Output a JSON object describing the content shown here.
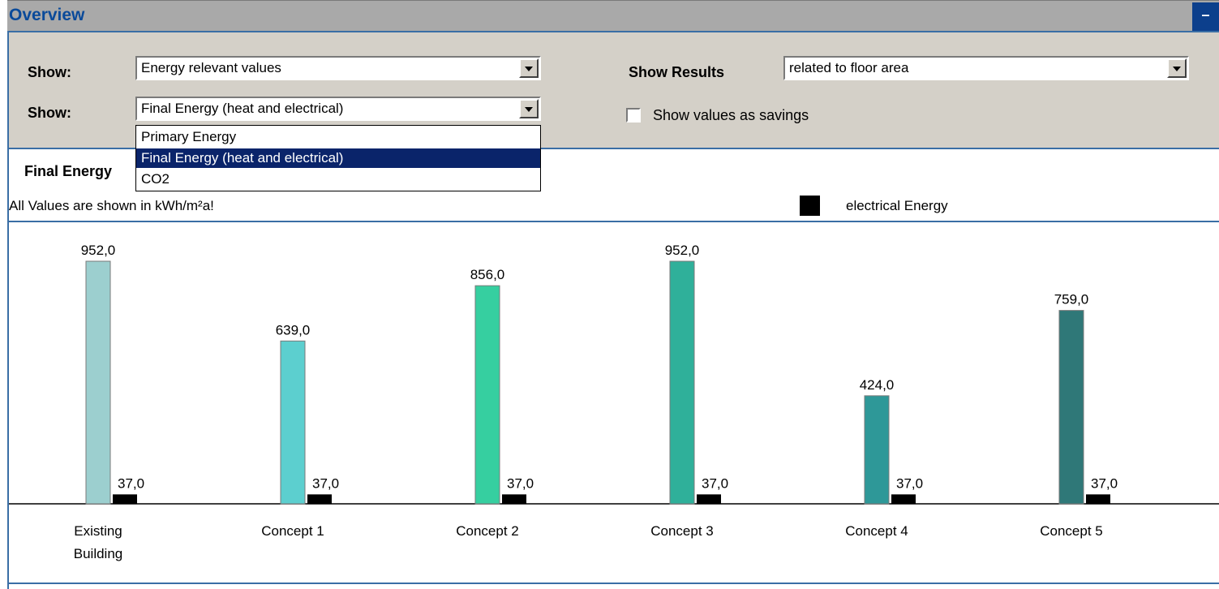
{
  "window": {
    "title": "Overview",
    "collapse_label": "–"
  },
  "filters": {
    "show1_label": "Show:",
    "show1_value": "Energy relevant values",
    "show2_label": "Show:",
    "show2_value": "Final Energy (heat and electrical)",
    "show_results_label": "Show Results",
    "show_results_value": "related to floor area",
    "savings_checkbox_label": "Show values as savings",
    "savings_checked": false
  },
  "dropdown": {
    "options": [
      "Primary Energy",
      "Final Energy (heat and electrical)",
      "CO2"
    ],
    "selected": "Final Energy (heat and electrical)"
  },
  "chart_header": {
    "title": "Final Energy",
    "unit_note": "All Values are shown in kWh/m²a!",
    "legend_label": "electrical Energy"
  },
  "colors": {
    "accent": "#3a6ea5",
    "selection": "#0a246a",
    "electrical": "#000000",
    "bars": [
      "#9ccfcf",
      "#5ccfcf",
      "#36cfa0",
      "#2fb09a",
      "#2e9898",
      "#2f7878"
    ]
  },
  "chart_data": {
    "type": "bar",
    "categories": [
      [
        "Existing",
        "Building"
      ],
      [
        "Concept 1"
      ],
      [
        "Concept 2"
      ],
      [
        "Concept 3"
      ],
      [
        "Concept 4"
      ],
      [
        "Concept 5"
      ]
    ],
    "series": [
      {
        "values": [
          952.0,
          639.0,
          856.0,
          952.0,
          424.0,
          759.0
        ],
        "labels": [
          "952,0",
          "639,0",
          "856,0",
          "952,0",
          "424,0",
          "759,0"
        ]
      },
      {
        "name": "electrical Energy",
        "values": [
          37.0,
          37.0,
          37.0,
          37.0,
          37.0,
          37.0
        ],
        "labels": [
          "37,0",
          "37,0",
          "37,0",
          "37,0",
          "37,0",
          "37,0"
        ]
      }
    ],
    "ylim": [
      0,
      952
    ],
    "grid": false,
    "legend": "top-right"
  }
}
